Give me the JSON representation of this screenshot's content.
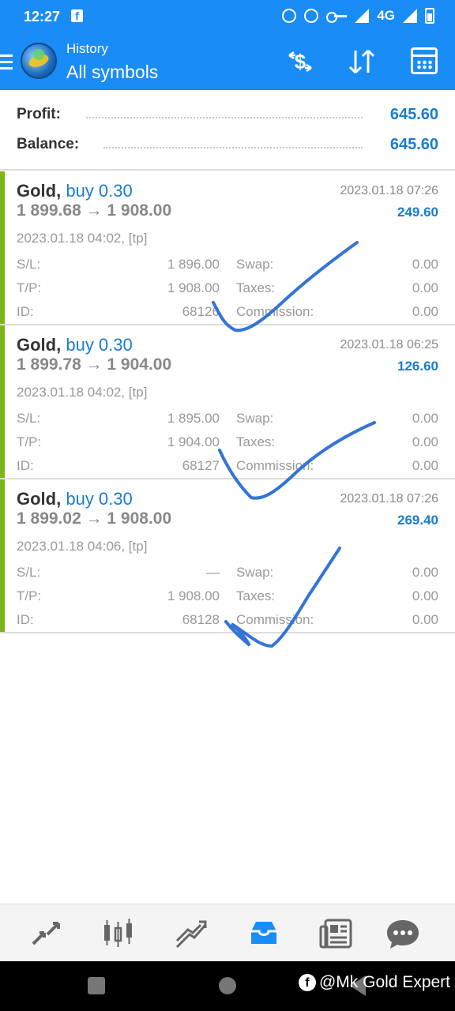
{
  "status_bar": {
    "time": "12:27",
    "network": "4G"
  },
  "header": {
    "subtitle": "History",
    "title": "All symbols"
  },
  "summary": {
    "profit_label": "Profit:",
    "profit_value": "645.60",
    "balance_label": "Balance:",
    "balance_value": "645.60"
  },
  "trades": [
    {
      "symbol": "Gold,",
      "side": "buy 0.30",
      "prices": "1 899.68 → 1 908.00",
      "close_time": "2023.01.18 07:26",
      "profit": "249.60",
      "open_info": "2023.01.18 04:02, [tp]",
      "sl_label": "S/L:",
      "sl": "1 896.00",
      "tp_label": "T/P:",
      "tp": "1 908.00",
      "id_label": "ID:",
      "id": "68126",
      "swap_label": "Swap:",
      "swap": "0.00",
      "taxes_label": "Taxes:",
      "taxes": "0.00",
      "commission_label": "Commission:",
      "commission": "0.00"
    },
    {
      "symbol": "Gold,",
      "side": "buy 0.30",
      "prices": "1 899.78 → 1 904.00",
      "close_time": "2023.01.18 06:25",
      "profit": "126.60",
      "open_info": "2023.01.18 04:02, [tp]",
      "sl_label": "S/L:",
      "sl": "1 895.00",
      "tp_label": "T/P:",
      "tp": "1 904.00",
      "id_label": "ID:",
      "id": "68127",
      "swap_label": "Swap:",
      "swap": "0.00",
      "taxes_label": "Taxes:",
      "taxes": "0.00",
      "commission_label": "Commission:",
      "commission": "0.00"
    },
    {
      "symbol": "Gold,",
      "side": "buy 0.30",
      "prices": "1 899.02 → 1 908.00",
      "close_time": "2023.01.18 07:26",
      "profit": "269.40",
      "open_info": "2023.01.18 04:06, [tp]",
      "sl_label": "S/L:",
      "sl": "—",
      "tp_label": "T/P:",
      "tp": "1 908.00",
      "id_label": "ID:",
      "id": "68128",
      "swap_label": "Swap:",
      "swap": "0.00",
      "taxes_label": "Taxes:",
      "taxes": "0.00",
      "commission_label": "Commission:",
      "commission": "0.00"
    }
  ],
  "bottom_nav": [
    "quotes-icon",
    "chart-icon",
    "trade-icon",
    "history-icon",
    "news-icon",
    "chat-icon"
  ],
  "watermark": "@Mk Gold Expert",
  "colors": {
    "accent_blue": "#1a8cf5",
    "profit_blue": "#1a7cd0",
    "trade_bar_green": "#7cb518",
    "check_mark_blue": "#3374d6"
  }
}
